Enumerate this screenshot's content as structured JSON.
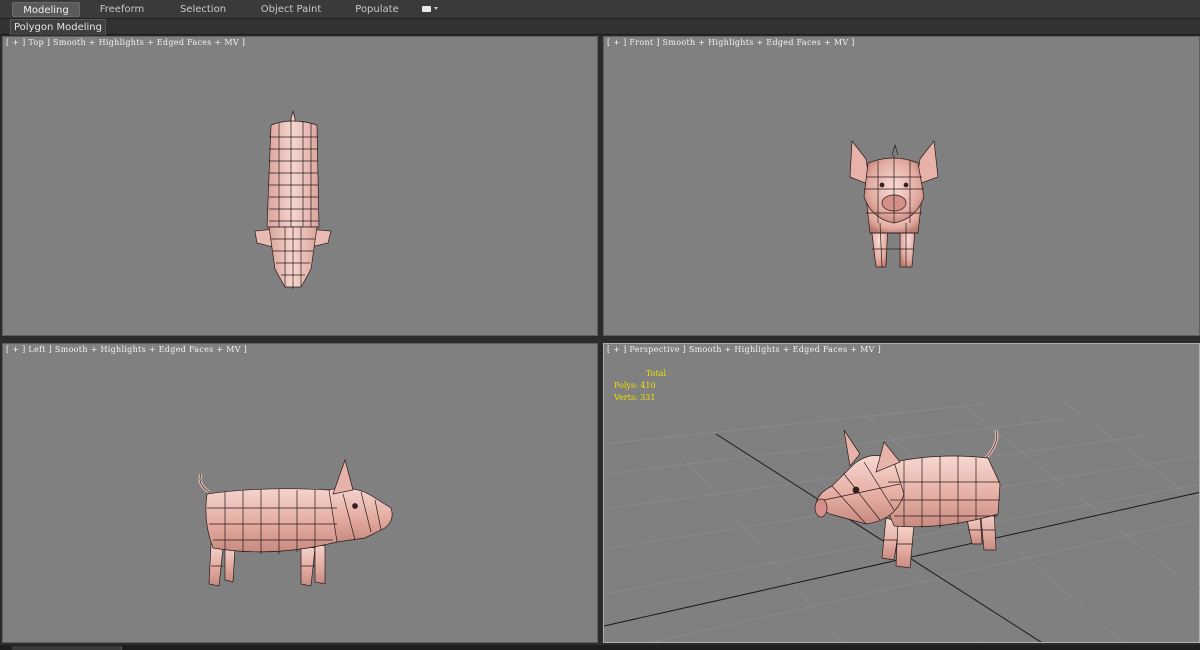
{
  "ribbon": {
    "tabs": [
      {
        "label": "Modeling",
        "active": true
      },
      {
        "label": "Freeform",
        "active": false
      },
      {
        "label": "Selection",
        "active": false
      },
      {
        "label": "Object Paint",
        "active": false
      },
      {
        "label": "Populate",
        "active": false
      }
    ],
    "dropdown_icon": "minimize-ribbon-icon",
    "sub_label": "Polygon Modeling"
  },
  "viewports": {
    "top": {
      "label": "[ + ] Top ] Smooth + Highlights + Edged Faces + MV ]"
    },
    "front": {
      "label": "[ + ] Front ] Smooth + Highlights + Edged Faces + MV ]"
    },
    "left": {
      "label": "[ + ] Left ] Smooth + Highlights + Edged Faces + MV ]"
    },
    "perspective": {
      "label": "[ + ] Perspective ] Smooth + Highlights + Edged Faces + MV ]",
      "stats": {
        "heading": "Total",
        "polys": "Polys: 410",
        "verts": "Verts: 331"
      }
    }
  },
  "colors": {
    "viewport_bg": "#808080",
    "pig_skin": "#f0c8c0",
    "pig_shade": "#c88a80",
    "wire": "#2a1a1a",
    "stats_text": "#f0e000"
  }
}
